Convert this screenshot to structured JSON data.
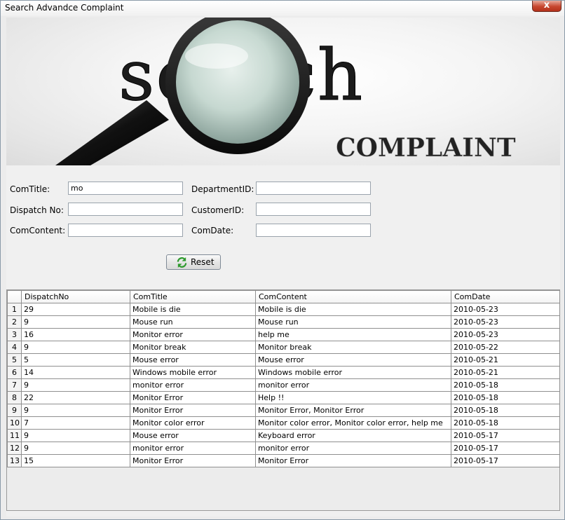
{
  "window": {
    "title": "Search Advandce Complaint",
    "close_label": "x"
  },
  "banner": {
    "word": "search",
    "subtitle": "COMPLAINT"
  },
  "form": {
    "comtitle": {
      "label": "ComTitle:",
      "value": "mo"
    },
    "dispatch_no": {
      "label": "Dispatch No:",
      "value": ""
    },
    "comcontent": {
      "label": "ComContent:",
      "value": ""
    },
    "department_id": {
      "label": "DepartmentID:",
      "value": ""
    },
    "customer_id": {
      "label": "CustomerID:",
      "value": ""
    },
    "comdate": {
      "label": "ComDate:",
      "value": ""
    },
    "reset_label": "Reset"
  },
  "table": {
    "columns": [
      "",
      "DispatchNo",
      "ComTitle",
      "ComContent",
      "ComDate"
    ],
    "rows": [
      [
        "1",
        "29",
        "Mobile is die",
        "Mobile is die",
        "2010-05-23"
      ],
      [
        "2",
        "9",
        "Mouse run",
        "Mouse run",
        "2010-05-23"
      ],
      [
        "3",
        "16",
        "Monitor error",
        "help me",
        "2010-05-23"
      ],
      [
        "4",
        "9",
        "Monitor break",
        "Monitor break",
        "2010-05-22"
      ],
      [
        "5",
        "5",
        "Mouse error",
        "Mouse error",
        "2010-05-21"
      ],
      [
        "6",
        "14",
        "Windows mobile error",
        "Windows mobile error",
        "2010-05-21"
      ],
      [
        "7",
        "9",
        "monitor error",
        "monitor error",
        "2010-05-18"
      ],
      [
        "8",
        "22",
        "Monitor Error",
        "Help !!",
        "2010-05-18"
      ],
      [
        "9",
        "9",
        "Monitor Error",
        "Monitor Error, Monitor Error",
        "2010-05-18"
      ],
      [
        "10",
        "7",
        "Monitor color error",
        "Monitor color error, Monitor color error, help me",
        "2010-05-18"
      ],
      [
        "11",
        "9",
        "Mouse error",
        "Keyboard error",
        "2010-05-17"
      ],
      [
        "12",
        "9",
        "monitor error",
        "monitor error",
        "2010-05-17"
      ],
      [
        "13",
        "15",
        "Monitor Error",
        "Monitor Error",
        "2010-05-17"
      ]
    ]
  }
}
